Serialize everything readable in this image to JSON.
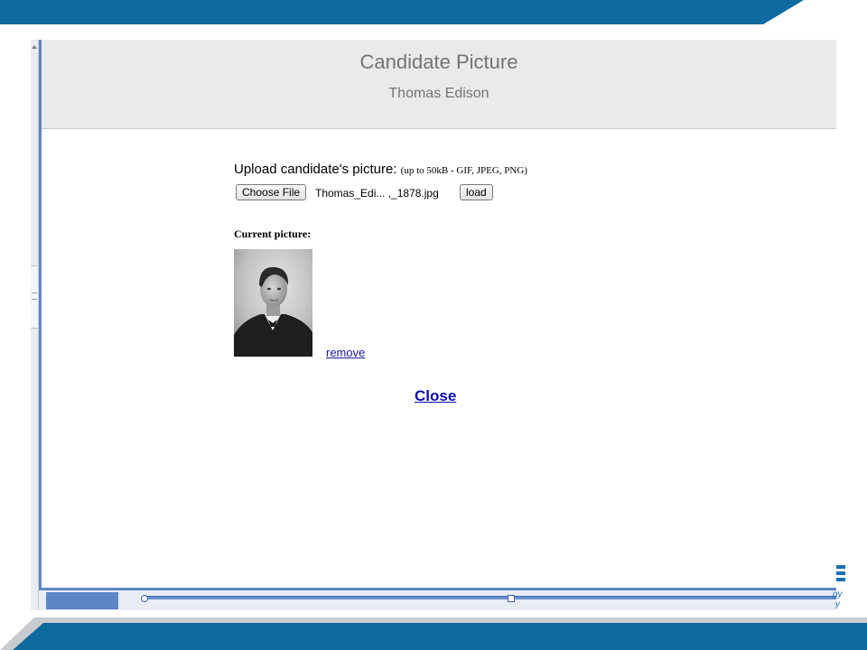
{
  "popup": {
    "title": "Candidate Picture",
    "subtitle": "Thomas Edison"
  },
  "upload": {
    "label": "Upload candidate's picture:",
    "hint": "(up to 50kB - GIF, JPEG, PNG)",
    "choose_file_label": "Choose File",
    "file_name": "Thomas_Edi... ,_1878.jpg",
    "load_label": "load"
  },
  "current": {
    "label": "Current picture:",
    "remove_label": "remove"
  },
  "close_label": "Close",
  "colors": {
    "slide_blue": "#0f6aa0",
    "popup_border": "#5f86c2",
    "link_blue": "#0a0aa8",
    "header_bg": "#e8eaec"
  },
  "bg_logo_text": [
    "gy",
    "y"
  ]
}
